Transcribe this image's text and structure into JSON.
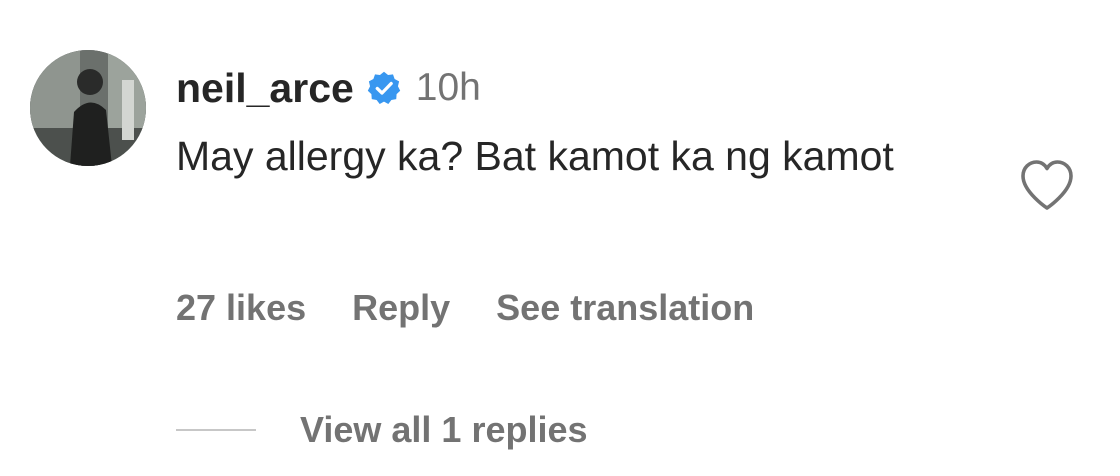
{
  "comment": {
    "avatar_icon": "user-avatar-photo",
    "username": "neil_arce",
    "verified_icon": "verified-badge-icon",
    "verified_color": "#3897f0",
    "time": "10h",
    "text": "May allergy ka? Bat kamot ka ng kamot",
    "like_icon": "heart-outline-icon",
    "actions": {
      "likes": "27 likes",
      "reply": "Reply",
      "translate": "See translation"
    },
    "view_replies": "View all 1 replies"
  },
  "colors": {
    "primary_text": "#262626",
    "secondary_text": "#737373",
    "divider": "#c7c7c7",
    "background": "#ffffff"
  }
}
